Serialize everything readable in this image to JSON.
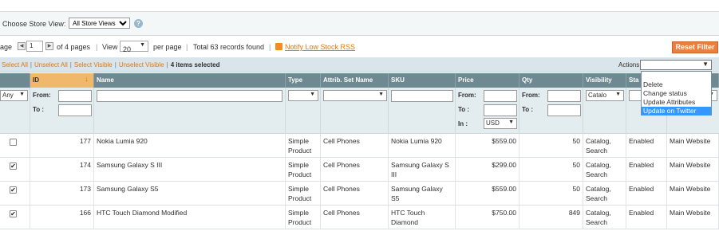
{
  "store": {
    "label": "Choose Store View:",
    "selected": "All Store Views",
    "help_glyph": "?"
  },
  "pager": {
    "page_label": "age",
    "page_value": "1",
    "of_pages": "of 4 pages",
    "view_label": "View",
    "view_value": "20",
    "per_page": "per page",
    "total": "Total 63 records found",
    "notify": "Notify Low Stock RSS",
    "reset": "Reset Filter"
  },
  "massactions": {
    "select_all": "Select All",
    "unselect_all": "Unselect All",
    "select_visible": "Select Visible",
    "unselect_visible": "Unselect Visible",
    "selected_count": "4 items selected",
    "actions_label": "Actions",
    "options": [
      "Delete",
      "Change status",
      "Update Attributes",
      "Update on Twitter"
    ],
    "highlighted": "Update on Twitter"
  },
  "columns": {
    "id": "ID",
    "name": "Name",
    "type": "Type",
    "attrset": "Attrib. Set Name",
    "sku": "SKU",
    "price": "Price",
    "qty": "Qty",
    "visibility": "Visibility",
    "status": "Sta"
  },
  "filters": {
    "any": "Any",
    "from": "From:",
    "to": "To :",
    "in": "In :",
    "currency": "USD",
    "visibility": "Catalo"
  },
  "rows": [
    {
      "checked": false,
      "id": "177",
      "name": "Nokia Lumia 920",
      "type": "Simple Product",
      "attrset": "Cell Phones",
      "sku": "Nokia Lumia 920",
      "price": "$559.00",
      "qty": "50",
      "visibility": "Catalog, Search",
      "status": "Enabled",
      "website": "Main Website"
    },
    {
      "checked": true,
      "id": "174",
      "name": "Samsung Galaxy S III",
      "type": "Simple Product",
      "attrset": "Cell Phones",
      "sku": "Samsung Galaxy S III",
      "price": "$299.00",
      "qty": "50",
      "visibility": "Catalog, Search",
      "status": "Enabled",
      "website": "Main Website"
    },
    {
      "checked": true,
      "id": "173",
      "name": "Samsung Galaxy S5",
      "type": "Simple Product",
      "attrset": "Cell Phones",
      "sku": "Samsung Galaxy S5",
      "price": "$559.00",
      "qty": "50",
      "visibility": "Catalog, Search",
      "status": "Enabled",
      "website": "Main Website"
    },
    {
      "checked": true,
      "id": "166",
      "name": "HTC Touch Diamond Modified",
      "type": "Simple Product",
      "attrset": "Cell Phones",
      "sku": "HTC Touch Diamond",
      "price": "$750.00",
      "qty": "849",
      "visibility": "Catalog, Search",
      "status": "Enabled",
      "website": "Main Website"
    }
  ]
}
